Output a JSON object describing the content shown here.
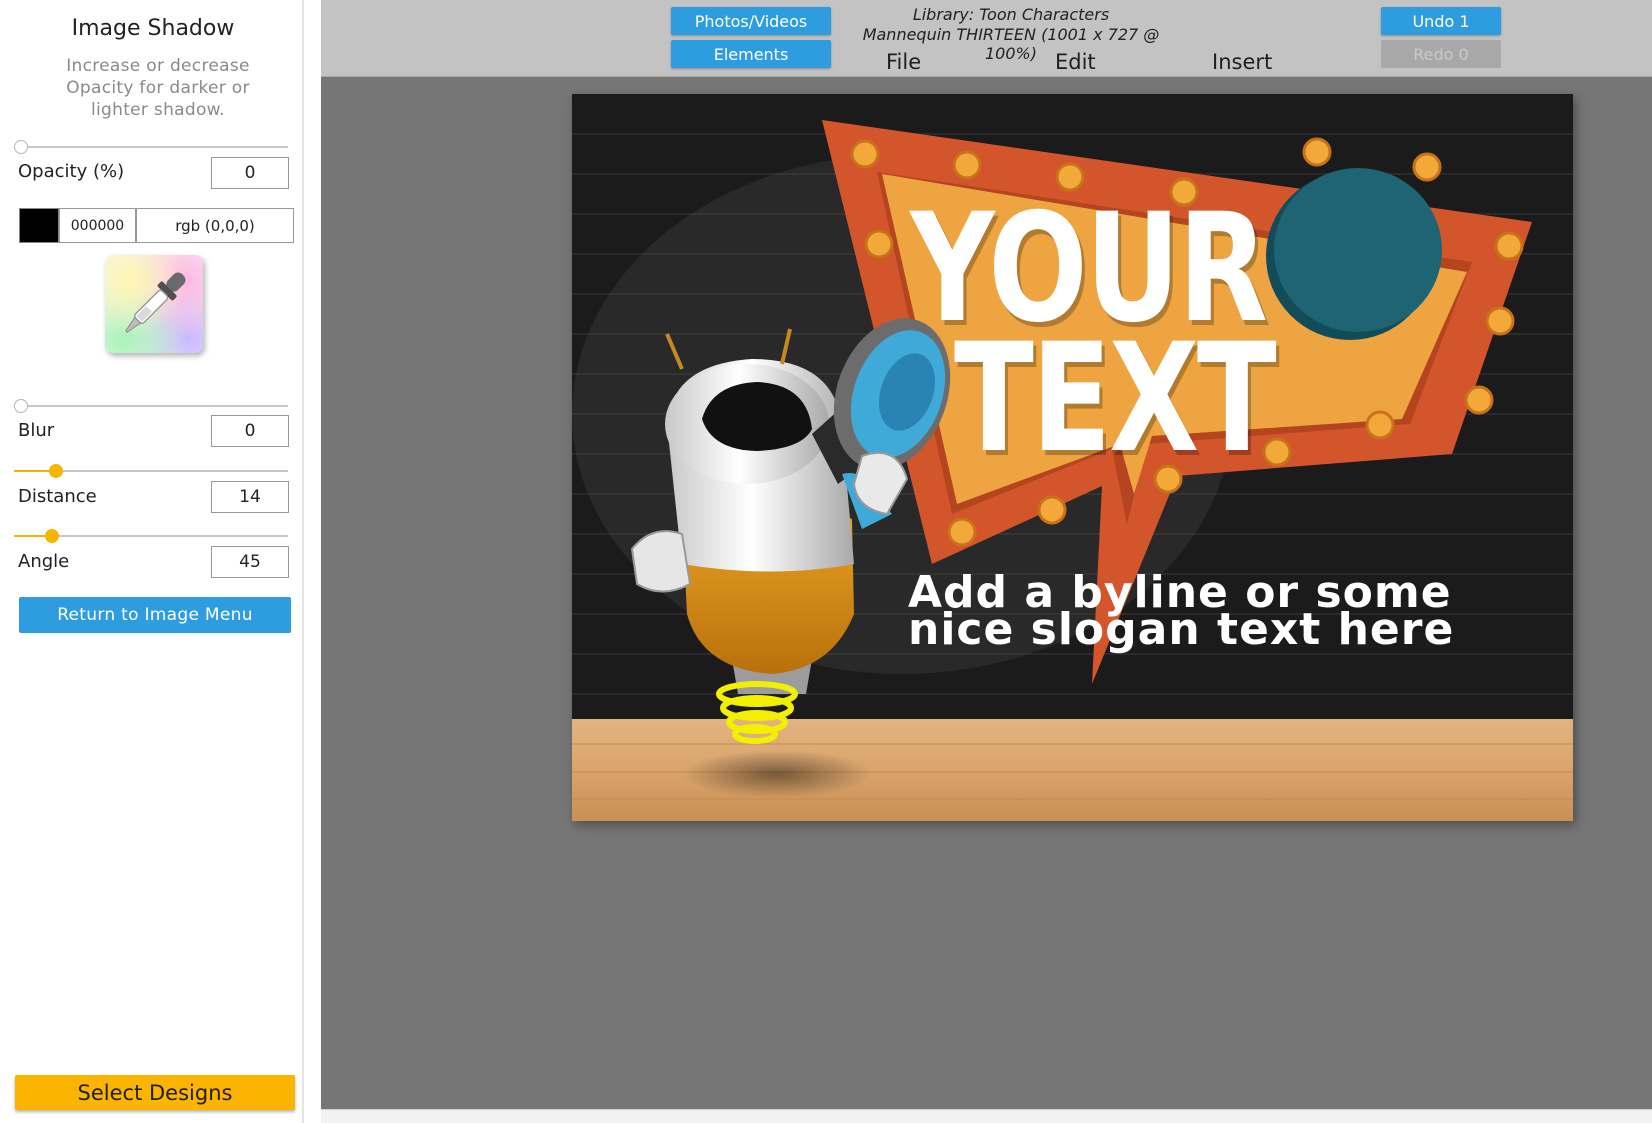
{
  "sidebar": {
    "title": "Image Shadow",
    "description": "Increase or decrease Opacity for darker or lighter shadow.",
    "opacity": {
      "label": "Opacity (%)",
      "value": "0",
      "slider_fraction": 0
    },
    "color": {
      "swatch": "#000000",
      "hex": "000000",
      "rgb": "rgb (0,0,0)"
    },
    "picker_icon": "eyedropper-icon",
    "blur": {
      "label": "Blur",
      "value": "0",
      "slider_fraction": 0
    },
    "distance": {
      "label": "Distance",
      "value": "14",
      "slider_fraction": 0.14
    },
    "angle": {
      "label": "Angle",
      "value": "45",
      "slider_fraction": 0.125
    },
    "return_button": "Return to Image Menu",
    "select_designs_button": "Select Designs"
  },
  "topbar": {
    "photos_videos": "Photos/Videos",
    "elements": "Elements",
    "library_line1": "Library: Toon Characters",
    "library_line2": "Mannequin THIRTEEN (1001 x 727 @ 100%)",
    "menu": [
      "File",
      "Edit",
      "Insert"
    ],
    "undo": "Undo 1",
    "redo": "Redo 0"
  },
  "canvas": {
    "headline_line1": "YOUR",
    "headline_line2": "TEXT",
    "byline_line1": "Add a byline or some",
    "byline_line2": "nice slogan text here"
  },
  "colors": {
    "accent_blue": "#2d9de0",
    "accent_yellow": "#fbb400",
    "sign_orange": "#d3552c",
    "sign_gold": "#eda441",
    "sign_teal": "#1e6473"
  }
}
